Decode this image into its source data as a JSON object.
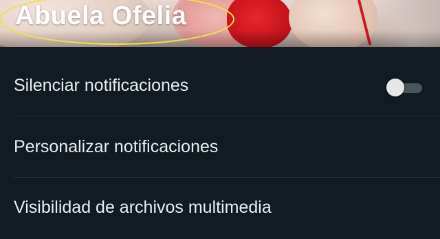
{
  "header": {
    "contact_name": "Abuela Ofelia",
    "highlight_color": "#f2e04a"
  },
  "settings": {
    "mute_notifications": {
      "label": "Silenciar notificaciones",
      "enabled": false
    },
    "custom_notifications": {
      "label": "Personalizar notificaciones"
    },
    "media_visibility": {
      "label": "Visibilidad de archivos multimedia"
    }
  },
  "colors": {
    "background": "#121b22",
    "text": "#e9edef",
    "divider": "#25323b",
    "toggle_track_off": "#4a555c",
    "toggle_thumb_off": "#e6e6e6"
  }
}
